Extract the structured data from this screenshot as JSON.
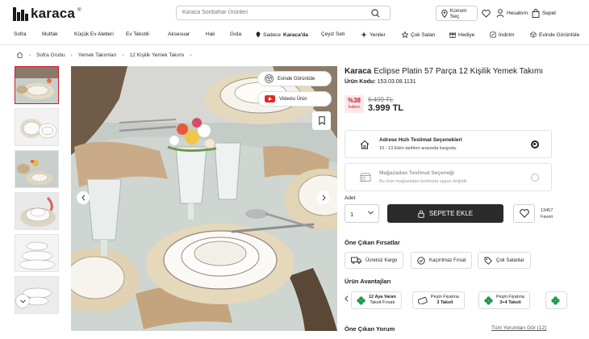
{
  "header": {
    "brand": "karaca",
    "search_placeholder": "Karaca Sonbahar Ürünleri",
    "location_label": "Konum Seç",
    "account_label": "Hesabım",
    "cart_label": "Sepet"
  },
  "nav": {
    "items": [
      "Sofra",
      "Mutfak",
      "Küçük Ev Aletleri",
      "Ev Tekstili",
      "Aksesuar",
      "Halı",
      "Gıda",
      "Sadece",
      "Karaca'da",
      "Çeyiz Seti",
      "Yeniler",
      "Çok Satan",
      "Hediye",
      "İndirim",
      "Evinde Görüntüle"
    ]
  },
  "breadcrumb": [
    "Sofra Grubu",
    "Yemek Takımları",
    "12 Kişilik Yemek Takımı"
  ],
  "gallery": {
    "view_at_home_label": "Evinde Görüntüle",
    "video_label": "Videolu Ürün"
  },
  "product": {
    "brand": "Karaca",
    "name": "Eclipse Platin 57 Parça 12 Kişilik Yemek Takımı",
    "code_label": "Ürün Kodu:",
    "code": "153.03.08.1131",
    "discount_percent": "%38",
    "discount_label": "İndirim",
    "old_price": "6.499 TL",
    "price": "3.999 TL"
  },
  "delivery": {
    "fast_title": "Adrese Hızlı Teslimat Seçenekleri",
    "fast_sub": "10 - 13 Ekim tarihleri arasında kargoda.",
    "store_title": "Mağazadan Teslimat Seçeneği",
    "store_sub": "Bu ürün mağazadan teslimata uygun değildir"
  },
  "purchase": {
    "qty_label": "Adet",
    "qty_value": "1",
    "add_to_cart": "SEPETE EKLE",
    "favorite_count": "13457",
    "favorite_label": "Favori"
  },
  "features": {
    "title": "Öne Çıkan Fırsatlar",
    "items": [
      "Ücretsiz Kargo",
      "Kaçırılmaz Fırsat",
      "Çok Satanlar"
    ]
  },
  "advantages": {
    "title": "Ürün Avantajları",
    "items": [
      {
        "line1": "12 Aya Varan",
        "line2": "Taksit Fırsatı"
      },
      {
        "line1": "Peşin Fiyatına",
        "line2": "3 Taksit"
      },
      {
        "line1": "Peşin Fiyatına",
        "line2": "3+4 Taksit"
      }
    ]
  },
  "reviews": {
    "title": "Öne Çıkan Yorum",
    "all_label": "Tüm Yorumları Gör (12)"
  },
  "colors": {
    "brand_red": "#c51b2b",
    "dark": "#2b2b2b"
  }
}
